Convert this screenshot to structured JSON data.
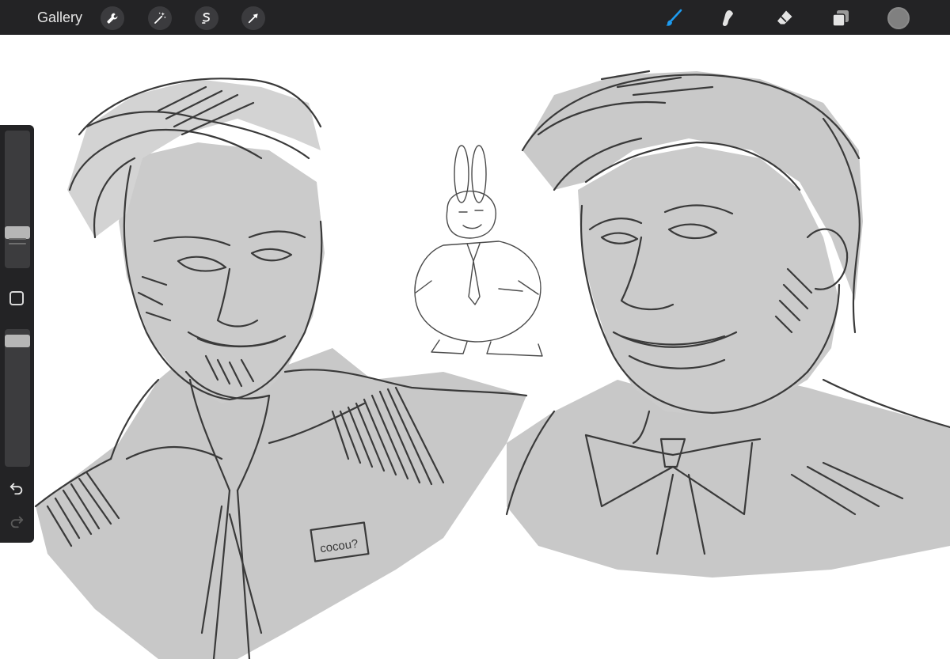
{
  "toolbar": {
    "gallery_label": "Gallery",
    "left_tools": [
      "wrench-icon",
      "magic-wand-icon",
      "selection-icon",
      "transform-arrow-icon"
    ],
    "right_tools": [
      "brush-icon",
      "smudge-icon",
      "eraser-icon",
      "layers-icon"
    ],
    "active_tool": "brush",
    "accent_color": "#1d9bf0",
    "current_color": "#808080"
  },
  "sidebar": {
    "brush_size_level": 0.22,
    "opacity_level": 0.98,
    "modify_button": "square-icon",
    "undo_icon": "undo-icon",
    "redo_icon": "redo-icon"
  },
  "canvas": {
    "background": "#ffffff",
    "sketch_tone": "#c8c8c8",
    "line_color": "#3a3a3a",
    "name_tag_text": "cocou?"
  }
}
